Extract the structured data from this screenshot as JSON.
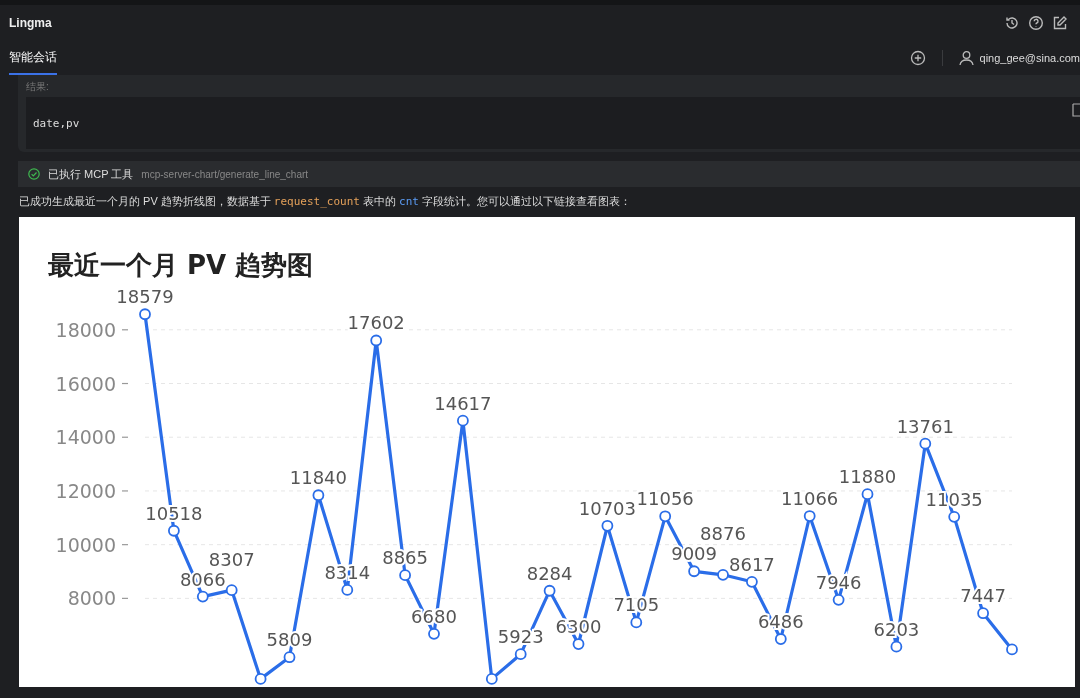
{
  "window": {
    "title": "Lingma"
  },
  "tabs": [
    {
      "label": "智能会话",
      "selected": true
    }
  ],
  "account": {
    "name": "qing_gee@sina.com"
  },
  "result_block": {
    "label": "结果:",
    "code": "date,pv"
  },
  "tool_call": {
    "status": "已执行 MCP 工具",
    "tool": "mcp-server-chart/generate_line_chart"
  },
  "reply": {
    "segments": [
      {
        "kind": "text",
        "text": "已成功生成最近一个月的 PV 趋势折线图，数据基于 "
      },
      {
        "kind": "code",
        "text": "request_count"
      },
      {
        "kind": "text",
        "text": " 表中的 "
      },
      {
        "kind": "field",
        "text": "cnt"
      },
      {
        "kind": "text",
        "text": " 字段统计。您可以通过以下链接查看图表："
      }
    ],
    "chart_data": {
      "type": "line",
      "title": "最近一个月 PV 趋势图",
      "grid": true,
      "ylim": [
        4700,
        22200
      ],
      "yticks": [
        8000,
        10000,
        12000,
        14000,
        16000,
        18000
      ],
      "categories": [
        null,
        null,
        null,
        null,
        null,
        null,
        null,
        null,
        null,
        null,
        null,
        null,
        null,
        null,
        null,
        null,
        null,
        null,
        null,
        null,
        null,
        null,
        null,
        null,
        null,
        null,
        null,
        null,
        null,
        null,
        null
      ],
      "series": [
        {
          "color": "#2a6de8",
          "marker": "circle",
          "values": [
            18579,
            10518,
            8066,
            8307,
            5000,
            5809,
            11840,
            8314,
            17602,
            8865,
            6680,
            14617,
            5000,
            5923,
            8284,
            6300,
            10703,
            7105,
            11056,
            9009,
            8876,
            8617,
            6486,
            11066,
            7946,
            11880,
            6203,
            13761,
            11035,
            7447,
            6100
          ],
          "value_labels": [
            "18579",
            "10518",
            "8066",
            "8307",
            null,
            "5809",
            "11840",
            "8314",
            "17602",
            "8865",
            "6680",
            "14617",
            null,
            "5923",
            "8284",
            "6300",
            "10703",
            "7105",
            "11056",
            "9009",
            "8876",
            "8617",
            "6486",
            "11066",
            "7946",
            "11880",
            "6203",
            "13761",
            "11035",
            "7447",
            null
          ]
        }
      ]
    }
  }
}
